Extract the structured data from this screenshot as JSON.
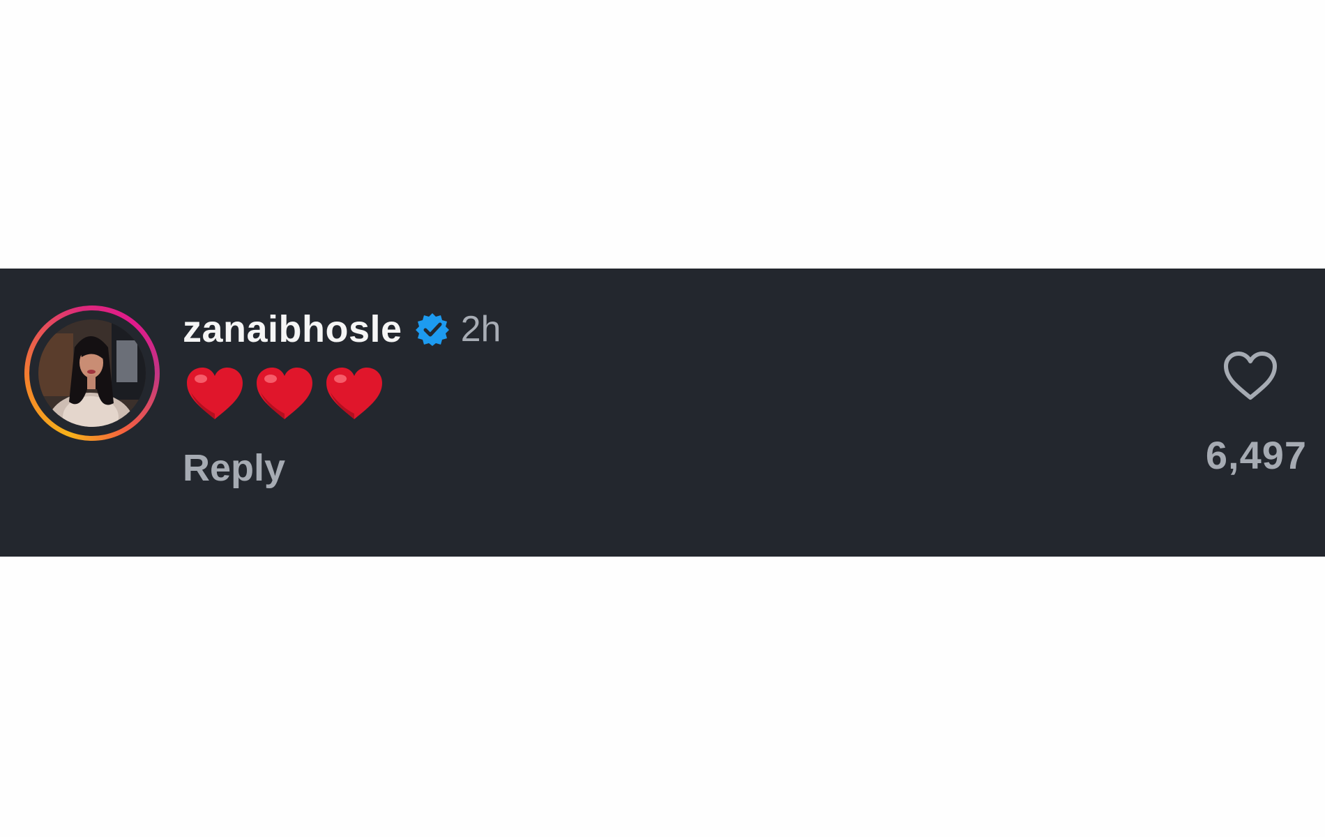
{
  "comment": {
    "username": "zanaibhosle",
    "verified_icon": "verified-badge-icon",
    "timestamp": "2h",
    "content_emojis": [
      "red-heart",
      "red-heart",
      "red-heart"
    ],
    "reply_label": "Reply",
    "like_icon": "heart-outline-icon",
    "like_count": "6,497"
  },
  "colors": {
    "band_background": "#23272e",
    "username": "#f5f5f5",
    "muted_text": "#a6abb3",
    "verified_blue": "#1d9bf0",
    "heart_red": "#e0162b",
    "story_ring_start": "#f7b21a",
    "story_ring_end": "#e1198c"
  }
}
